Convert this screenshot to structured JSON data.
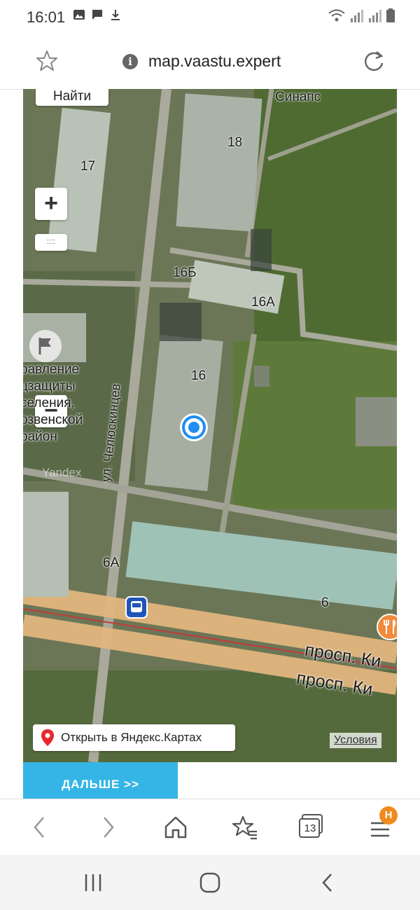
{
  "status": {
    "time": "16:01"
  },
  "address_bar": {
    "url": "map.vaastu.expert",
    "star_icon": "star-outline-icon",
    "info_icon": "i",
    "reload_icon": "reload-icon"
  },
  "map": {
    "search_button": "Найти",
    "zoom_in": "+",
    "zoom_out": "−",
    "ruler": "::::",
    "street_label": "ул. Челюскинцев",
    "avenue_label_1": "просп. Ки",
    "avenue_label_2": "просп. Ки",
    "poi_label_lines": [
      "равление",
      "цзащиты",
      "селения,",
      "озвенской",
      "район"
    ],
    "house_numbers": {
      "h18": "18",
      "h17": "17",
      "h16b": "16Б",
      "h16a": "16А",
      "h16": "16",
      "h6a": "6А",
      "h6": "6"
    },
    "place_label": "Синапс",
    "watermark": "Yandex",
    "open_in_yandex": "Открыть в Яндекс.Картах",
    "terms": "Условия",
    "accent_colors": {
      "location": "#1f8ef1",
      "next_button": "#35b5e6",
      "badge": "#f08a1c",
      "pin": "#e8282d",
      "restaurant": "#f28a3b"
    }
  },
  "next_button": "ДАЛЬШЕ >>",
  "browser_toolbar": {
    "tabs_count": "13",
    "badge": "Н"
  }
}
